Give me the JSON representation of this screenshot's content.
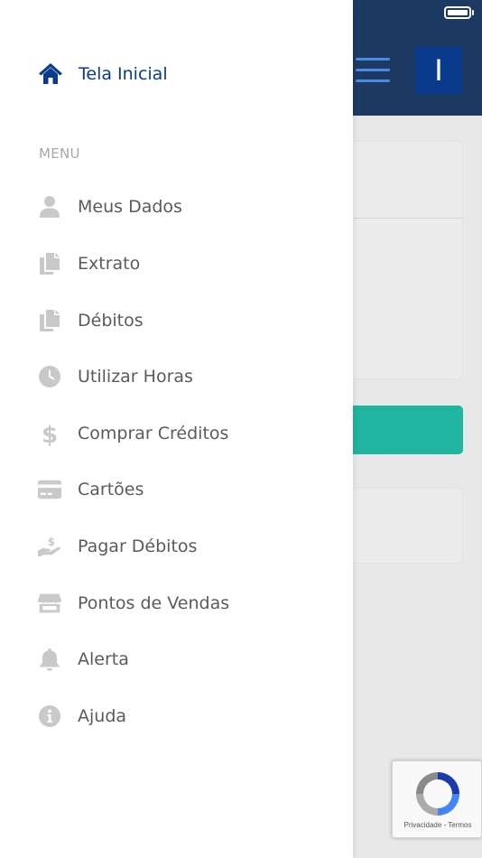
{
  "status_bar": {
    "battery_icon": "battery-full-icon"
  },
  "header": {
    "menu_icon": "hamburger-menu-icon",
    "avatar_letter": "I",
    "background_color": "#1d3a63",
    "avatar_color": "#0a3a8c"
  },
  "background": {
    "accent_button_color": "#1fb5a0"
  },
  "drawer": {
    "home": {
      "label": "Tela Inicial",
      "icon": "home-icon",
      "color": "#0a3a8c"
    },
    "section_label": "MENU",
    "items": [
      {
        "label": "Meus Dados",
        "icon": "user-icon"
      },
      {
        "label": "Extrato",
        "icon": "document-copy-icon"
      },
      {
        "label": "Débitos",
        "icon": "document-copy-icon"
      },
      {
        "label": "Utilizar Horas",
        "icon": "clock-icon"
      },
      {
        "label": "Comprar Créditos",
        "icon": "dollar-icon"
      },
      {
        "label": "Cartões",
        "icon": "credit-card-icon"
      },
      {
        "label": "Pagar Débitos",
        "icon": "hand-dollar-icon"
      },
      {
        "label": "Pontos de Vendas",
        "icon": "store-icon"
      },
      {
        "label": "Alerta",
        "icon": "bell-icon"
      },
      {
        "label": "Ajuda",
        "icon": "info-icon"
      }
    ]
  },
  "recaptcha": {
    "privacy": "Privacidade",
    "separator": "-",
    "terms": "Termos"
  }
}
